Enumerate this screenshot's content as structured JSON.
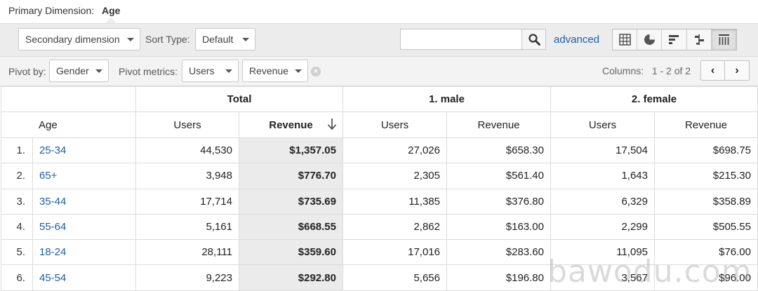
{
  "primary_dimension": {
    "label": "Primary Dimension:",
    "value": "Age"
  },
  "toolbar": {
    "secondary_dimension": "Secondary dimension",
    "sort_type_label": "Sort Type:",
    "sort_type_value": "Default",
    "search_value": "",
    "advanced": "advanced",
    "view_icons": [
      "table-view-icon",
      "pie-view-icon",
      "performance-view-icon",
      "comparison-view-icon",
      "pivot-view-icon"
    ]
  },
  "pivot": {
    "pivot_by_label": "Pivot by:",
    "pivot_by_value": "Gender",
    "pivot_metrics_label": "Pivot metrics:",
    "metric1": "Users",
    "metric2": "Revenue",
    "columns_label": "Columns:",
    "columns_range": "1 - 2 of 2",
    "prev": "‹",
    "next": "›"
  },
  "table": {
    "groups": [
      "Total",
      "1. male",
      "2. female"
    ],
    "dimension_header": "Age",
    "metric_headers": [
      "Users",
      "Revenue",
      "Users",
      "Revenue",
      "Users",
      "Revenue"
    ],
    "sorted_column": 1,
    "rows": [
      {
        "idx": "1.",
        "age": "25-34",
        "values": [
          "44,530",
          "$1,357.05",
          "27,026",
          "$658.30",
          "17,504",
          "$698.75"
        ]
      },
      {
        "idx": "2.",
        "age": "65+",
        "values": [
          "3,948",
          "$776.70",
          "2,305",
          "$561.40",
          "1,643",
          "$215.30"
        ]
      },
      {
        "idx": "3.",
        "age": "35-44",
        "values": [
          "17,714",
          "$735.69",
          "11,385",
          "$376.80",
          "6,329",
          "$358.89"
        ]
      },
      {
        "idx": "4.",
        "age": "55-64",
        "values": [
          "5,161",
          "$668.55",
          "2,862",
          "$163.00",
          "2,299",
          "$505.55"
        ]
      },
      {
        "idx": "5.",
        "age": "18-24",
        "values": [
          "28,111",
          "$359.60",
          "17,016",
          "$283.60",
          "11,095",
          "$76.00"
        ]
      },
      {
        "idx": "6.",
        "age": "45-54",
        "values": [
          "9,223",
          "$292.80",
          "5,656",
          "$196.80",
          "3,567",
          "$96.00"
        ]
      }
    ]
  },
  "watermark": "bawodu.com"
}
